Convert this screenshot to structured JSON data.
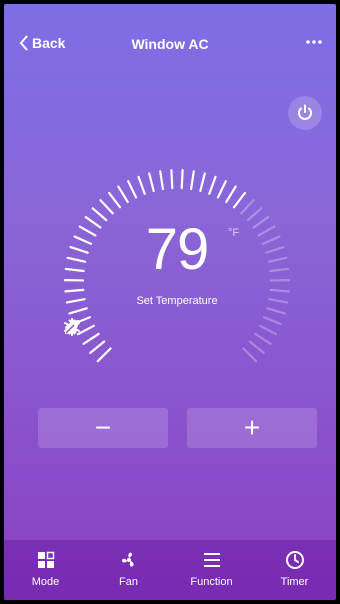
{
  "header": {
    "back_label": "Back",
    "title": "Window AC"
  },
  "thermostat": {
    "temperature": "79",
    "unit": "°F",
    "caption": "Set Temperature",
    "mode_icons": [
      "snowflake-icon",
      "fan-icon",
      "leaf-icon"
    ]
  },
  "controls": {
    "decrease_label": "−",
    "increase_label": "+"
  },
  "tabs": [
    {
      "label": "Mode",
      "icon": "mode-icon"
    },
    {
      "label": "Fan",
      "icon": "fan-icon"
    },
    {
      "label": "Function",
      "icon": "menu-icon"
    },
    {
      "label": "Timer",
      "icon": "clock-icon"
    }
  ],
  "colors": {
    "bg_top": "#7e6ee6",
    "bg_bottom": "#8b3fc2"
  }
}
